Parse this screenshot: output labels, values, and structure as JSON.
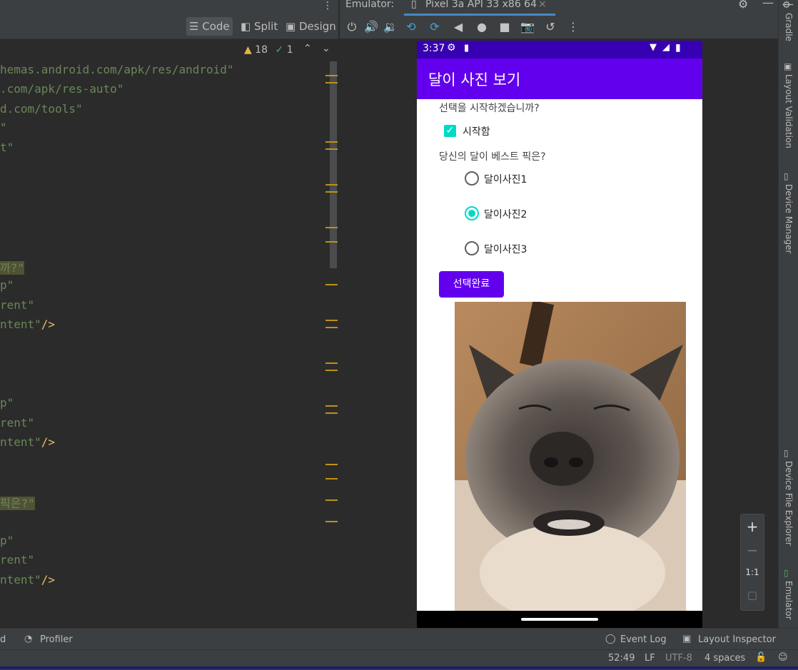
{
  "editor": {
    "mode_buttons": {
      "code": "Code",
      "split": "Split",
      "design": "Design"
    },
    "warnings_count": "18",
    "ok_count": "1",
    "lines": [
      {
        "text": "hemas.android.com/apk/res/android\"",
        "highlight": false
      },
      {
        "text": ".com/apk/res-auto\"",
        "highlight": false
      },
      {
        "text": "d.com/tools\"",
        "highlight": false
      },
      {
        "text": "\"",
        "highlight": false
      },
      {
        "text": "t\"",
        "highlight": false
      },
      {
        "text": "까?\"",
        "highlight": true
      },
      {
        "text": "p\"",
        "highlight": false
      },
      {
        "text": "rent\"",
        "highlight": false
      },
      {
        "text": "ntent\"",
        "tag": "/>",
        "highlight": false
      },
      {
        "text": "p\"",
        "highlight": false
      },
      {
        "text": "rent\"",
        "highlight": false
      },
      {
        "text": "ntent\"",
        "tag": "/>",
        "highlight": false
      },
      {
        "text": "픽은?\"",
        "highlight": true
      },
      {
        "text": "p\"",
        "highlight": false
      },
      {
        "text": "rent\"",
        "highlight": false
      },
      {
        "text": "ntent\"",
        "tag": "/>",
        "highlight": false
      }
    ]
  },
  "emulator": {
    "label": "Emulator:",
    "device_tab": "Pixel 3a API 33 x86 64",
    "toolbar_icons": [
      "power-icon",
      "volume-up-icon",
      "volume-down-icon",
      "rotate-left-icon",
      "rotate-right-icon",
      "back-icon",
      "home-icon",
      "overview-icon",
      "camera-icon",
      "replay-icon",
      "more-icon"
    ]
  },
  "phone": {
    "time": "3:37",
    "app_title": "달이 사진 보기",
    "start_question": "선택을 시작하겠습니까?",
    "checkbox_label": "시작함",
    "checkbox_checked": true,
    "best_question": "당신의 달이 베스트 픽은?",
    "radios": [
      {
        "label": "달이사진1",
        "selected": false
      },
      {
        "label": "달이사진2",
        "selected": true
      },
      {
        "label": "달이사진3",
        "selected": false
      }
    ],
    "done_button": "선택완료",
    "accent": "#6200ee",
    "teal": "#03dac5"
  },
  "sidebar": {
    "tabs": [
      "Gradle",
      "Layout Validation",
      "Device Manager",
      "Device File Explorer",
      "Emulator"
    ]
  },
  "zoom": {
    "one_to_one": "1:1"
  },
  "bottom": {
    "left_cut": "d",
    "profiler": "Profiler",
    "event_log": "Event Log",
    "layout_inspector": "Layout Inspector",
    "position": "52:49",
    "line_sep": "LF",
    "encoding": "UTF-8",
    "indent": "4 spaces"
  }
}
